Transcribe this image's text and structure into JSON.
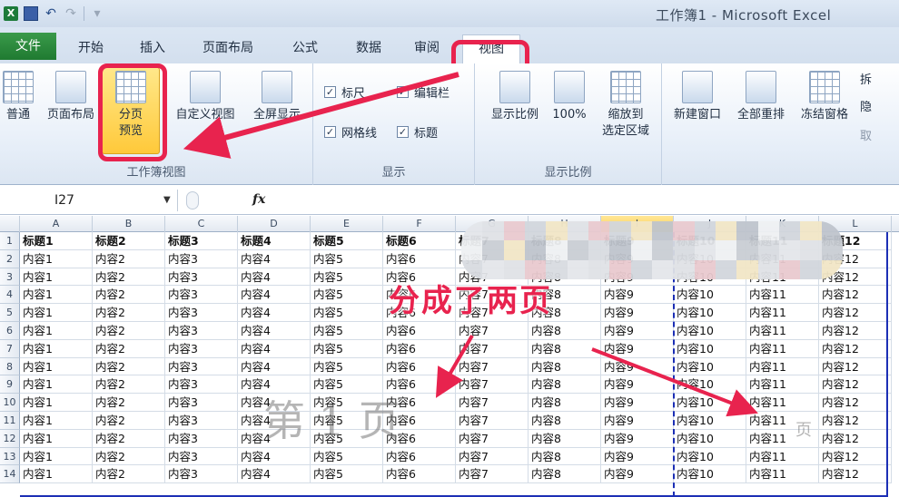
{
  "window": {
    "title": "工作簿1 - Microsoft Excel"
  },
  "qat": {
    "app_icon": "X"
  },
  "tabs": [
    {
      "id": "file",
      "label": "文件"
    },
    {
      "id": "home",
      "label": "开始"
    },
    {
      "id": "insert",
      "label": "插入"
    },
    {
      "id": "layout",
      "label": "页面布局"
    },
    {
      "id": "formulas",
      "label": "公式"
    },
    {
      "id": "data",
      "label": "数据"
    },
    {
      "id": "review",
      "label": "审阅"
    },
    {
      "id": "view",
      "label": "视图"
    }
  ],
  "ribbon": {
    "workbook_views": {
      "label": "工作簿视图",
      "normal": "普通",
      "page_layout": "页面布局",
      "page_break_line1": "分页",
      "page_break_line2": "预览",
      "custom_views": "自定义视图",
      "full_screen": "全屏显示"
    },
    "show": {
      "label": "显示",
      "ruler": "标尺",
      "formula_bar": "编辑栏",
      "gridlines": "网格线",
      "headings": "标题"
    },
    "zoom": {
      "label": "显示比例",
      "zoom": "显示比例",
      "hundred": "100%",
      "zoom_to_selection_line1": "缩放到",
      "zoom_to_selection_line2": "选定区域"
    },
    "window": {
      "new_window": "新建窗口",
      "arrange_all": "全部重排",
      "freeze_panes": "冻结窗格",
      "split": "拆",
      "hide": "隐",
      "unhide": "取"
    }
  },
  "formula_bar": {
    "name_box": "I27",
    "fx": "fx",
    "value": ""
  },
  "sheet": {
    "columns": [
      "A",
      "B",
      "C",
      "D",
      "E",
      "F",
      "G",
      "H",
      "I",
      "J",
      "K",
      "L"
    ],
    "row_numbers": [
      "1",
      "2",
      "3",
      "4",
      "5",
      "6",
      "7",
      "8",
      "9",
      "10",
      "11",
      "12",
      "13",
      "14"
    ],
    "headers": [
      "标题1",
      "标题2",
      "标题3",
      "标题4",
      "标题5",
      "标题6",
      "标题7",
      "标题8",
      "标题9",
      "标题10",
      "标题11",
      "标题12"
    ],
    "content": [
      "内容1",
      "内容2",
      "内容3",
      "内容4",
      "内容5",
      "内容6",
      "内容7",
      "内容8",
      "内容9",
      "内容10",
      "内容11",
      "内容12"
    ],
    "page1_watermark": "第 1 页",
    "page2_watermark": "页"
  },
  "annotation": {
    "text": "分成了两页"
  },
  "colors": {
    "highlight": "#e8234e",
    "page_break": "#1c2fb5",
    "active_button": "#ffd24a"
  }
}
